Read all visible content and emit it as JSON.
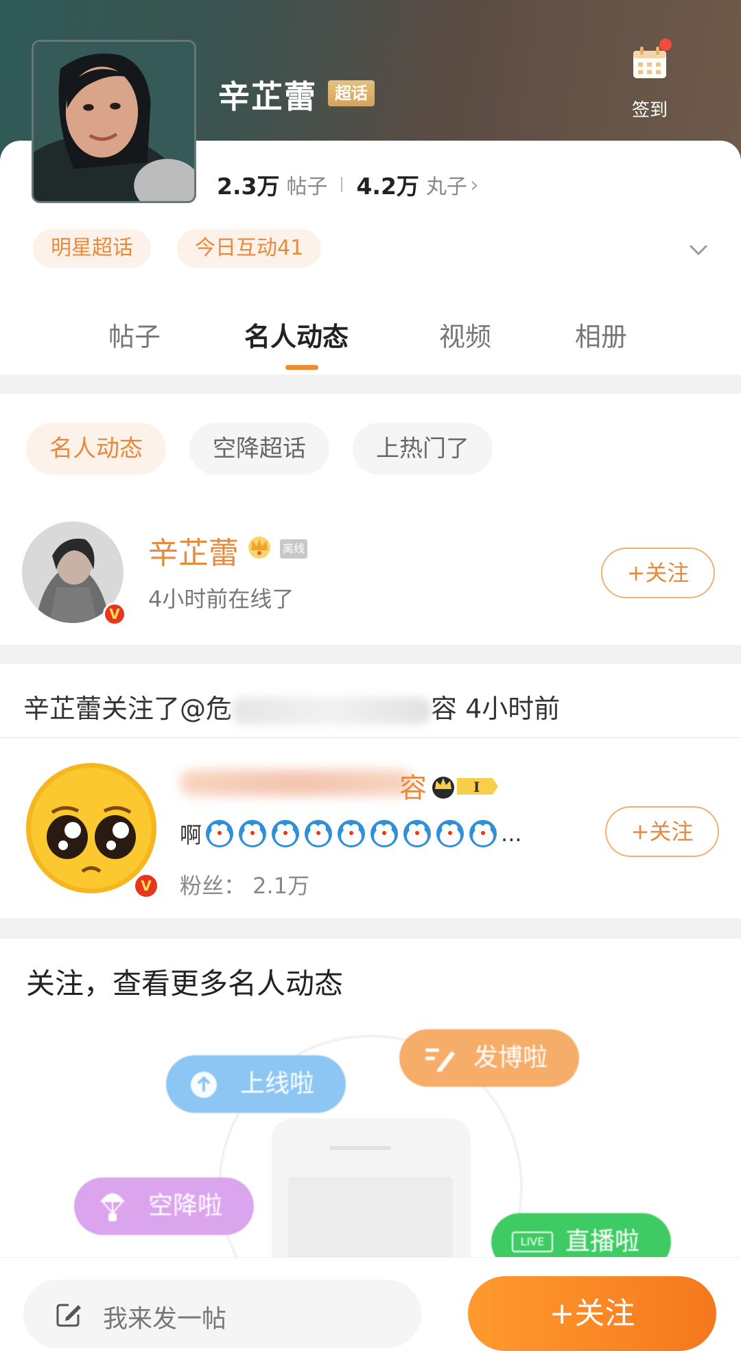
{
  "header": {
    "topic_title": "辛芷蕾",
    "topic_tag": "超话",
    "checkin_label": "签到",
    "posts_count": "2.3万",
    "posts_unit": "帖子",
    "points_count": "4.2万",
    "points_unit": "丸子"
  },
  "pills": [
    "明星超话",
    "今日互动41"
  ],
  "tabs": [
    "帖子",
    "名人动态",
    "视频",
    "相册"
  ],
  "active_tab_index": 1,
  "filters": [
    "名人动态",
    "空降超话",
    "上热门了"
  ],
  "celebrity": {
    "name": "辛芷蕾",
    "status_tag": "离线",
    "last_online": "4小时前在线了",
    "follow_label": "+关注"
  },
  "activity": {
    "prefix": "辛芷蕾关注了@危",
    "suffix": "容 4小时前"
  },
  "followed_user": {
    "name_tail": "容",
    "level": "I",
    "post_prefix": "啊",
    "post_suffix": "...",
    "fans": "粉丝：  2.1万",
    "follow_label": "+关注"
  },
  "cta": "关注，查看更多名人动态",
  "float_chips": [
    "上线啦",
    "发博啦",
    "空降啦",
    "直播啦"
  ],
  "live_badge": "LIVE",
  "bottom": {
    "compose_placeholder": "我来发一帖",
    "follow_label": "+关注"
  },
  "colors": {
    "accent": "#e8893b",
    "brand_orange": "#ff9a2e",
    "verified_red": "#e8361e"
  }
}
